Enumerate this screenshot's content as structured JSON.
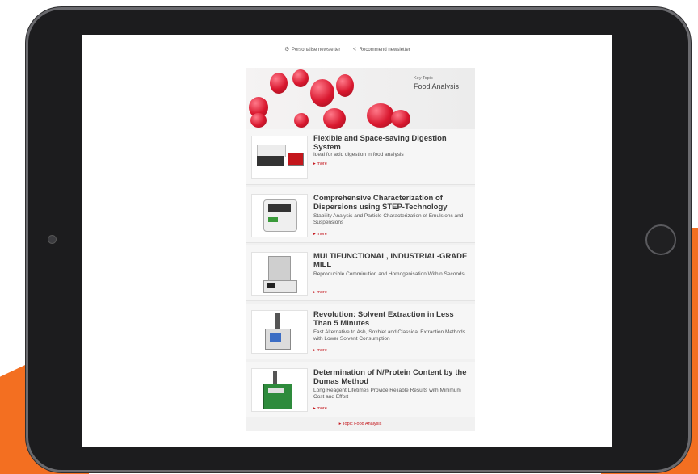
{
  "toolbar": {
    "personalise_label": "Personalise newsletter",
    "recommend_label": "Recommend newsletter"
  },
  "hero": {
    "key_label": "Key Topic",
    "topic_label": "Food Analysis"
  },
  "articles": [
    {
      "title": "Flexible and Space-saving Digestion System",
      "desc": "Ideal for acid digestion in food analysis",
      "more": "more"
    },
    {
      "title": "Comprehensive Characterization of Dispersions using STEP-Technology",
      "desc": "Stability Analysis and Particle Characterization of Emulsions and Suspensions",
      "more": "more"
    },
    {
      "title": "MULTIFUNCTIONAL, INDUSTRIAL-GRADE MILL",
      "desc": "Reproducible Comminution and Homogenisation Within Seconds",
      "more": "more"
    },
    {
      "title": "Revolution: Solvent Extraction in Less Than 5 Minutes",
      "desc": "Fast Alternative to Ash, Soxhlet and Classical Extraction Methods with Lower Solvent Consumption",
      "more": "more"
    },
    {
      "title": "Determination of N/Protein Content by the Dumas Method",
      "desc": "Long Reagent Lifetimes Provide Reliable Results with Minimum Cost and Effort",
      "more": "more"
    }
  ],
  "footer": {
    "topic_link": "Topic Food Analysis"
  },
  "colors": {
    "accent": "#c4161c",
    "brand_orange": "#f36f21",
    "bezel": "#1c1c1e"
  }
}
